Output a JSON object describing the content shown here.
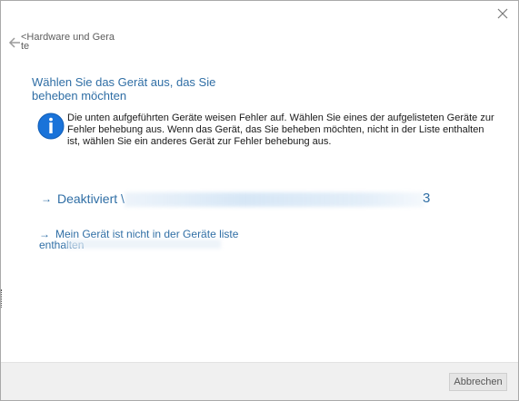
{
  "window": {
    "close_icon": "close-icon"
  },
  "nav": {
    "back_label": "<Hardware und Gerate",
    "back_icon": "back-arrow-icon"
  },
  "main": {
    "heading": "Wählen Sie das Gerät aus, das Sie beheben möchten",
    "info_icon": "info-icon",
    "info_text": "Die unten aufgeführten Geräte weisen Fehler auf. Wählen Sie eines der aufgelisteten Geräte zur Fehler behebung aus. Wenn das Gerät, das Sie beheben möchten, nicht in der Liste enthalten ist, wählen Sie ein anderes Gerät zur Fehler behebung aus.",
    "device_link": {
      "arrow": "→",
      "label": "Deaktiviert \\",
      "tail": "3"
    },
    "not_listed_link": {
      "arrow": "→",
      "label": "Mein Gerät ist nicht in der Geräte liste enthalten"
    }
  },
  "footer": {
    "cancel_label": "Abbrechen"
  },
  "colors": {
    "link": "#2f6ea5",
    "info_blue": "#1a73d9",
    "footer_bg": "#f0f0f0"
  }
}
